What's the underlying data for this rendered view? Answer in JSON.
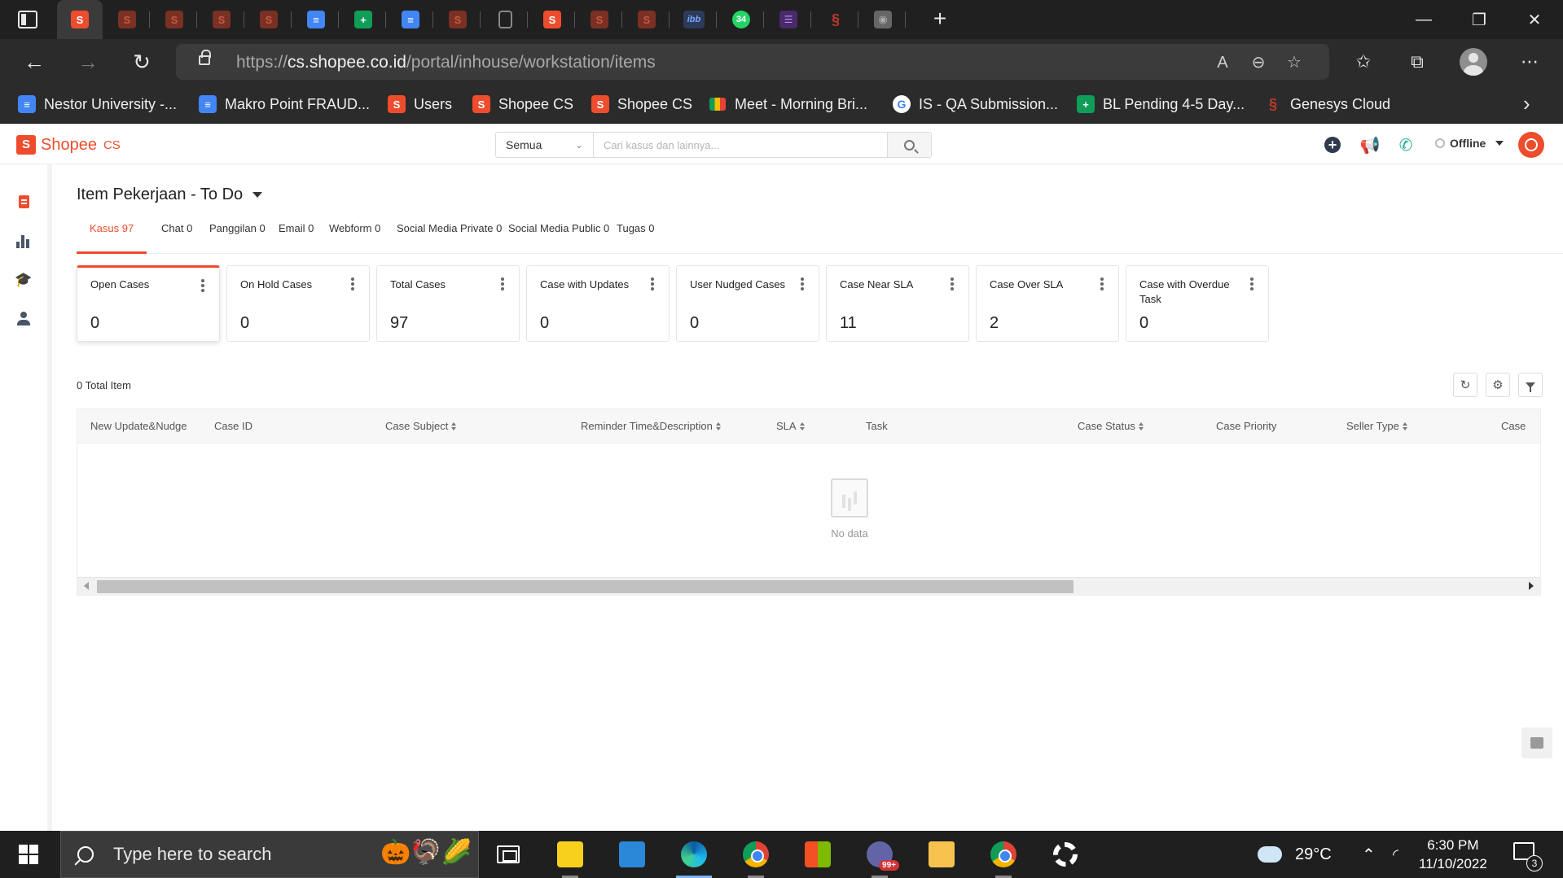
{
  "browser": {
    "url_scheme": "https://",
    "url_host": "cs.shopee.co.id",
    "url_path": "/portal/inhouse/workstation/items",
    "tabs": [
      {
        "icon": "shopee-icon",
        "active": true
      },
      {
        "icon": "shopee-icon"
      },
      {
        "icon": "shopee-icon"
      },
      {
        "icon": "shopee-icon"
      },
      {
        "icon": "shopee-icon"
      },
      {
        "icon": "google-docs-icon"
      },
      {
        "icon": "google-sheets-icon"
      },
      {
        "icon": "google-docs-icon"
      },
      {
        "icon": "shopee-icon"
      },
      {
        "icon": "blank-page-icon"
      },
      {
        "icon": "shopee-icon"
      },
      {
        "icon": "shopee-icon"
      },
      {
        "icon": "shopee-icon"
      },
      {
        "icon": "ibb-icon",
        "text": "ibb"
      },
      {
        "icon": "whatsapp-icon",
        "text": "34"
      },
      {
        "icon": "form-icon"
      },
      {
        "icon": "genesys-icon"
      },
      {
        "icon": "grey-app-icon"
      }
    ],
    "bookmarks": [
      {
        "icon": "google-docs-icon",
        "label": "Nestor University -..."
      },
      {
        "icon": "google-docs-icon",
        "label": "Makro Point FRAUD..."
      },
      {
        "icon": "shopee-icon",
        "label": "Users"
      },
      {
        "icon": "shopee-icon",
        "label": "Shopee CS"
      },
      {
        "icon": "shopee-icon",
        "label": "Shopee CS"
      },
      {
        "icon": "google-meet-icon",
        "label": "Meet - Morning Bri..."
      },
      {
        "icon": "google-icon",
        "label": "IS - QA Submission..."
      },
      {
        "icon": "google-sheets-icon",
        "label": "BL Pending 4-5 Day..."
      },
      {
        "icon": "genesys-icon",
        "label": "Genesys Cloud"
      }
    ]
  },
  "app": {
    "logo_text": "Shopee",
    "logo_suffix": "CS",
    "search": {
      "scope": "Semua",
      "placeholder": "Cari kasus dan lainnya..."
    },
    "status": "Offline",
    "brand_color": "#ee4d2d"
  },
  "page": {
    "title": "Item Pekerjaan - To Do",
    "tabs": [
      {
        "label": "Kasus 97",
        "active": true
      },
      {
        "label": "Chat 0"
      },
      {
        "label": "Panggilan 0"
      },
      {
        "label": "Email 0"
      },
      {
        "label": "Webform 0"
      },
      {
        "label": "Social Media Private 0"
      },
      {
        "label": "Social Media Public 0"
      },
      {
        "label": "Tugas 0"
      }
    ],
    "cards": [
      {
        "label": "Open Cases",
        "value": "0",
        "active": true
      },
      {
        "label": "On Hold Cases",
        "value": "0"
      },
      {
        "label": "Total Cases",
        "value": "97"
      },
      {
        "label": "Case with Updates",
        "value": "0"
      },
      {
        "label": "User Nudged Cases",
        "value": "0"
      },
      {
        "label": "Case Near SLA",
        "value": "11"
      },
      {
        "label": "Case Over SLA",
        "value": "2"
      },
      {
        "label": "Case with Overdue Task",
        "value": "0"
      }
    ],
    "total_item": "0 Total Item",
    "columns": [
      {
        "label": "New Update&Nudge",
        "sortable": false
      },
      {
        "label": "Case ID",
        "sortable": false
      },
      {
        "label": "Case Subject",
        "sortable": true
      },
      {
        "label": "Reminder Time&Description",
        "sortable": true
      },
      {
        "label": "SLA",
        "sortable": true
      },
      {
        "label": "Task",
        "sortable": false
      },
      {
        "label": "Case Status",
        "sortable": true
      },
      {
        "label": "Case Priority",
        "sortable": false
      },
      {
        "label": "Seller Type",
        "sortable": true
      },
      {
        "label": "Case",
        "sortable": false
      }
    ],
    "empty_text": "No data"
  },
  "taskbar": {
    "search_placeholder": "Type here to search",
    "temperature": "29°C",
    "time": "6:30 PM",
    "date": "11/10/2022",
    "notification_count": "3",
    "teams_badge": "99+"
  }
}
